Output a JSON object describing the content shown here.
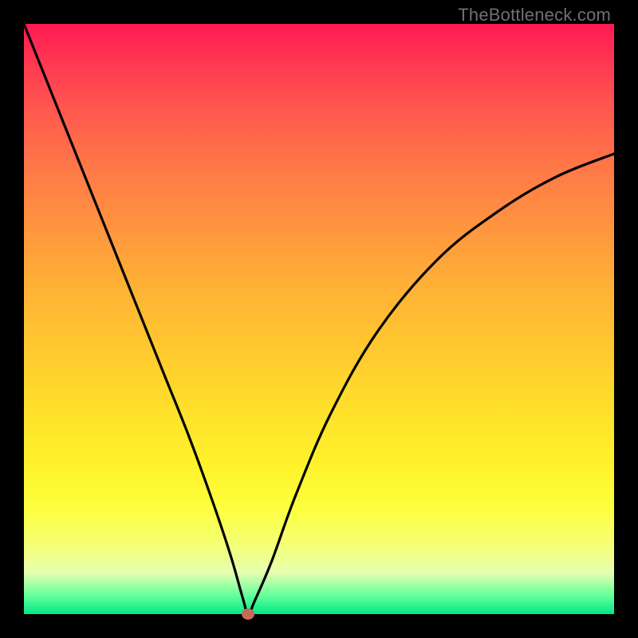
{
  "watermark": "TheBottleneck.com",
  "chart_data": {
    "type": "line",
    "title": "",
    "xlabel": "",
    "ylabel": "",
    "xlim": [
      0,
      100
    ],
    "ylim": [
      0,
      100
    ],
    "note": "V-shaped bottleneck curve over a red-to-green vertical gradient background. Minimum (optimal point) near x≈38, y≈0. Left branch is very steep; right branch is shallower and concave.",
    "series": [
      {
        "name": "bottleneck-curve",
        "x": [
          0,
          4,
          8,
          12,
          16,
          20,
          24,
          28,
          32,
          35,
          37,
          38,
          39,
          42,
          46,
          52,
          60,
          70,
          80,
          90,
          100
        ],
        "values": [
          100,
          90,
          80,
          70,
          60,
          50,
          40,
          30,
          19,
          10,
          3,
          0,
          2,
          9,
          20,
          34,
          48,
          60,
          68,
          74,
          78
        ]
      }
    ],
    "marker": {
      "x": 38,
      "y": 0,
      "color": "#c66a5b"
    },
    "gradient_stops": [
      {
        "pos": 0,
        "color": "#ff1a53"
      },
      {
        "pos": 50,
        "color": "#ffc82f"
      },
      {
        "pos": 85,
        "color": "#f8ff55"
      },
      {
        "pos": 100,
        "color": "#00e883"
      }
    ]
  }
}
